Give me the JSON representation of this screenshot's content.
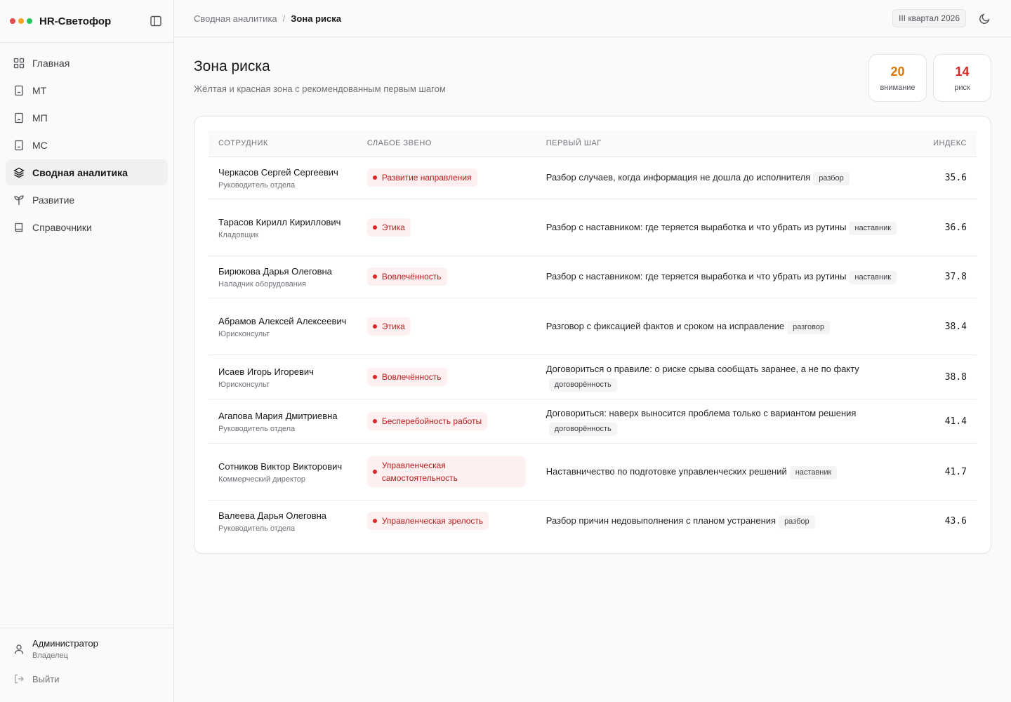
{
  "app": {
    "title": "HR-Светофор",
    "brand_colors": [
      "#e5484d",
      "#f5a524",
      "#22c55e"
    ]
  },
  "sidebar": {
    "items": [
      {
        "label": "Главная",
        "icon": "grid-icon",
        "active": false
      },
      {
        "label": "МТ",
        "icon": "building-icon",
        "active": false
      },
      {
        "label": "МП",
        "icon": "building-icon",
        "active": false
      },
      {
        "label": "МС",
        "icon": "building-icon",
        "active": false
      },
      {
        "label": "Сводная аналитика",
        "icon": "layers-icon",
        "active": true
      },
      {
        "label": "Развитие",
        "icon": "sprout-icon",
        "active": false
      },
      {
        "label": "Справочники",
        "icon": "book-icon",
        "active": false
      }
    ],
    "user": {
      "name": "Администратор",
      "role": "Владелец"
    },
    "logout_label": "Выйти"
  },
  "header": {
    "breadcrumb_parent": "Сводная аналитика",
    "breadcrumb_sep": "/",
    "breadcrumb_current": "Зона риска",
    "period": "III квартал 2026"
  },
  "page": {
    "title": "Зона риска",
    "subtitle": "Жёлтая и красная зона с рекомендованным первым шагом"
  },
  "stats": {
    "attention": {
      "value": "20",
      "label": "внимание",
      "color": "#d97706"
    },
    "risk": {
      "value": "14",
      "label": "риск",
      "color": "#dc2626"
    }
  },
  "table": {
    "headers": {
      "employee": "СОТРУДНИК",
      "weak": "СЛАБОЕ ЗВЕНО",
      "step": "ПЕРВЫЙ ШАГ",
      "index": "ИНДЕКС"
    },
    "rows": [
      {
        "name": "Черкасов Сергей Сергеевич",
        "position": "Руководитель отдела",
        "weak": "Развитие направления",
        "step": "Разбор случаев, когда информация не дошла до исполнителя",
        "tag": "разбор",
        "index": "35.6"
      },
      {
        "name": "Тарасов Кирилл Кириллович",
        "position": "Кладовщик",
        "weak": "Этика",
        "step": "Разбор с наставником: где теряется выработка и что убрать из рутины",
        "tag": "наставник",
        "index": "36.6"
      },
      {
        "name": "Бирюкова Дарья Олеговна",
        "position": "Наладчик оборудования",
        "weak": "Вовлечённость",
        "step": "Разбор с наставником: где теряется выработка и что убрать из рутины",
        "tag": "наставник",
        "index": "37.8"
      },
      {
        "name": "Абрамов Алексей Алексеевич",
        "position": "Юрисконсульт",
        "weak": "Этика",
        "step": "Разговор с фиксацией фактов и сроком на исправление",
        "tag": "разговор",
        "index": "38.4"
      },
      {
        "name": "Исаев Игорь Игоревич",
        "position": "Юрисконсульт",
        "weak": "Вовлечённость",
        "step": "Договориться о правиле: о риске срыва сообщать заранее, а не по факту",
        "tag": "договорённость",
        "index": "38.8"
      },
      {
        "name": "Агапова Мария Дмитриевна",
        "position": "Руководитель отдела",
        "weak": "Бесперебойность работы",
        "step": "Договориться: наверх выносится проблема только с вариантом решения",
        "tag": "договорённость",
        "index": "41.4"
      },
      {
        "name": "Сотников Виктор Викторович",
        "position": "Коммерческий директор",
        "weak": "Управленческая самостоятельность",
        "step": "Наставничество по подготовке управленческих решений",
        "tag": "наставник",
        "index": "41.7"
      },
      {
        "name": "Валеева Дарья Олеговна",
        "position": "Руководитель отдела",
        "weak": "Управленческая зрелость",
        "step": "Разбор причин недовыполнения с планом устранения",
        "tag": "разбор",
        "index": "43.6"
      }
    ]
  }
}
